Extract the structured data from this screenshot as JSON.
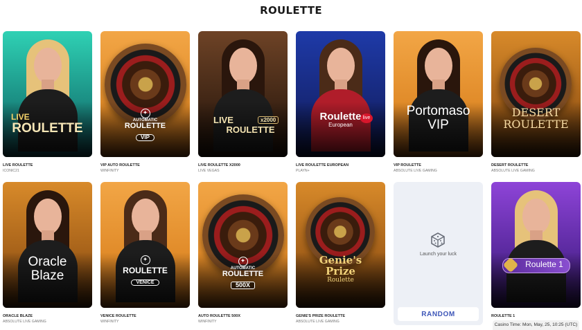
{
  "page": {
    "title": "ROULETTE"
  },
  "games": [
    {
      "name": "LIVE ROULETTE",
      "provider": "ICONIC21",
      "logo_line1": "LIVE",
      "logo_line2": "ROULETTE",
      "theme": "teal"
    },
    {
      "name": "VIP AUTO ROULETTE",
      "provider": "WINFINITY",
      "logo_line1": "AUTOMATIC",
      "logo_line2": "ROULETTE",
      "badge": "VIP",
      "theme": "orange"
    },
    {
      "name": "LIVE ROULETTE X2000",
      "provider": "LIVE VEGAS",
      "logo_line1": "LIVE",
      "logo_line2": "ROULETTE",
      "badge": "x2000",
      "theme": "brown"
    },
    {
      "name": "LIVE ROULETTE EUROPEAN",
      "provider": "PLAYN+",
      "logo_line1": "Roulette",
      "logo_line2": "European",
      "badge": "live",
      "theme": "blue"
    },
    {
      "name": "VIP ROULETTE",
      "provider": "ABSOLUTE LIVE GAMING",
      "logo_line1": "Portomaso",
      "logo_line2": "VIP",
      "theme": "orange"
    },
    {
      "name": "DESERT ROULETTE",
      "provider": "ABSOLUTE LIVE GAMING",
      "logo_line1": "DESERT",
      "logo_line2": "ROULETTE",
      "theme": "amber"
    },
    {
      "name": "ORACLE BLAZE",
      "provider": "ABSOLUTE LIVE GAMING",
      "logo_line1": "Oracle",
      "logo_line2": "Blaze",
      "theme": "amber"
    },
    {
      "name": "VENICE ROULETTE",
      "provider": "WINFINITY",
      "logo_line1": "ROULETTE",
      "logo_line2": "",
      "badge": "VENICE",
      "theme": "orange"
    },
    {
      "name": "AUTO ROULETTE 500X",
      "provider": "WINFINITY",
      "logo_line1": "AUTOMATIC",
      "logo_line2": "ROULETTE",
      "badge": "500X",
      "theme": "orange"
    },
    {
      "name": "GENIE'S PRIZE ROULETTE",
      "provider": "ABSOLUTE LIVE GAMING",
      "logo_line1": "Genie's",
      "logo_line2": "Prize",
      "logo_line3": "Roulette",
      "theme": "amber"
    },
    {
      "name": "ROULETTE 1",
      "provider": "",
      "logo_line1": "Roulette 1",
      "logo_line2": "",
      "theme": "purple"
    }
  ],
  "random": {
    "caption": "Launch your luck",
    "button_label": "RANDOM",
    "icon": "dice-icon"
  },
  "footer": {
    "casino_time": "Casino Time: Mon, May, 25, 10:25 (UTC)"
  },
  "colors": {
    "accent": "#3d56b8",
    "random_bg": "#edf0f6"
  }
}
